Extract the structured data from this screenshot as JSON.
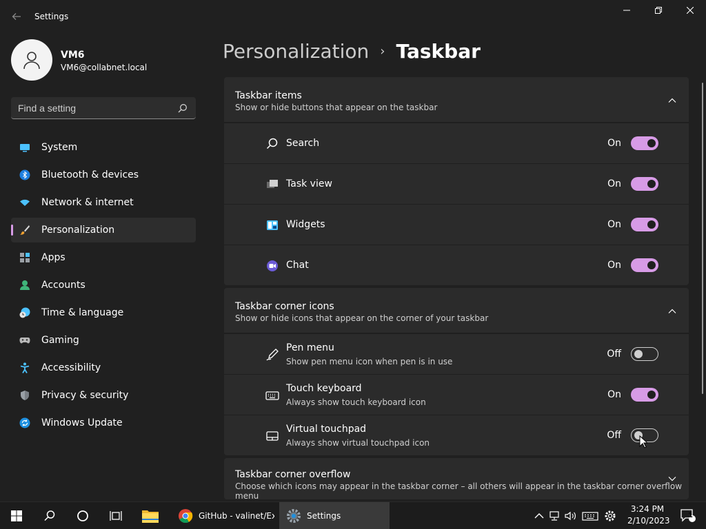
{
  "window": {
    "title": "Settings",
    "back_icon": "back-arrow-icon",
    "controls": [
      "minimize-icon",
      "restore-icon",
      "close-icon"
    ]
  },
  "user": {
    "name": "VM6",
    "email": "VM6@collabnet.local"
  },
  "search": {
    "placeholder": "Find a setting"
  },
  "nav": {
    "items": [
      {
        "label": "System",
        "icon": "system-icon"
      },
      {
        "label": "Bluetooth & devices",
        "icon": "bluetooth-icon"
      },
      {
        "label": "Network & internet",
        "icon": "wifi-icon"
      },
      {
        "label": "Personalization",
        "icon": "brush-icon",
        "selected": true
      },
      {
        "label": "Apps",
        "icon": "apps-icon"
      },
      {
        "label": "Accounts",
        "icon": "accounts-icon"
      },
      {
        "label": "Time & language",
        "icon": "clock-globe-icon"
      },
      {
        "label": "Gaming",
        "icon": "gamepad-icon"
      },
      {
        "label": "Accessibility",
        "icon": "accessibility-icon"
      },
      {
        "label": "Privacy & security",
        "icon": "shield-icon"
      },
      {
        "label": "Windows Update",
        "icon": "update-icon"
      }
    ]
  },
  "header": {
    "parent": "Personalization",
    "separator": "›",
    "current": "Taskbar"
  },
  "sections": {
    "taskbar_items": {
      "title": "Taskbar items",
      "subtitle": "Show or hide buttons that appear on the taskbar",
      "expanded": true,
      "rows": [
        {
          "label": "Search",
          "state": "On",
          "on": true,
          "icon": "search-icon"
        },
        {
          "label": "Task view",
          "state": "On",
          "on": true,
          "icon": "task-view-icon"
        },
        {
          "label": "Widgets",
          "state": "On",
          "on": true,
          "icon": "widgets-icon"
        },
        {
          "label": "Chat",
          "state": "On",
          "on": true,
          "icon": "chat-icon"
        }
      ]
    },
    "corner_icons": {
      "title": "Taskbar corner icons",
      "subtitle": "Show or hide icons that appear on the corner of your taskbar",
      "expanded": true,
      "rows": [
        {
          "label": "Pen menu",
          "sub": "Show pen menu icon when pen is in use",
          "state": "Off",
          "on": false,
          "icon": "pen-icon"
        },
        {
          "label": "Touch keyboard",
          "sub": "Always show touch keyboard icon",
          "state": "On",
          "on": true,
          "icon": "keyboard-icon"
        },
        {
          "label": "Virtual touchpad",
          "sub": "Always show virtual touchpad icon",
          "state": "Off",
          "on": false,
          "icon": "touchpad-icon"
        }
      ]
    },
    "corner_overflow": {
      "title": "Taskbar corner overflow",
      "subtitle": "Choose which icons may appear in the taskbar corner – all others will appear in the taskbar corner overflow menu",
      "expanded": false
    }
  },
  "taskbar": {
    "apps": [
      {
        "label": "GitHub - valinet/Ex...",
        "icon": "chrome-icon",
        "active": false
      },
      {
        "label": "Settings",
        "icon": "settings-gear-icon",
        "active": true
      }
    ],
    "clock": {
      "time": "3:24 PM",
      "date": "2/10/2023"
    },
    "notification_count": "1"
  },
  "colors": {
    "accent": "#d79be6",
    "background": "#202020",
    "card": "#2b2b2b"
  }
}
